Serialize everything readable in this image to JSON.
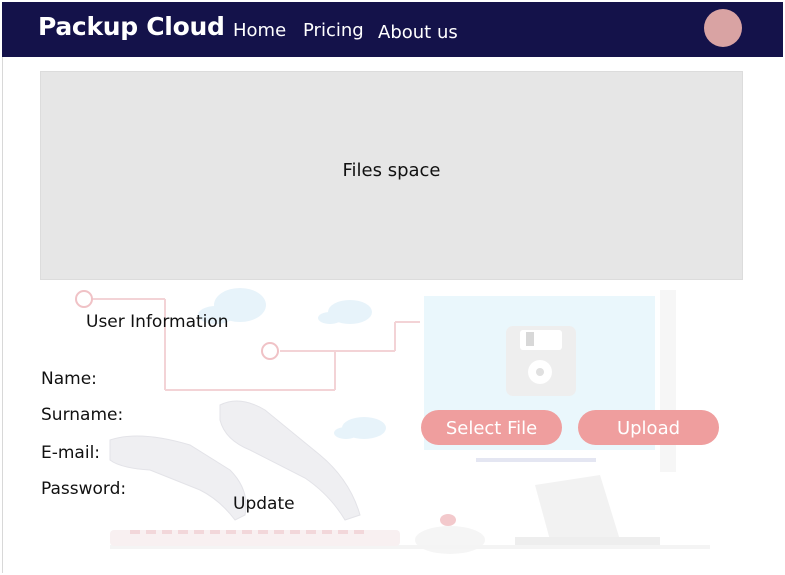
{
  "header": {
    "brand": "Packup Cloud",
    "nav": [
      {
        "label": "Home"
      },
      {
        "label": "Pricing"
      },
      {
        "label": "About us"
      }
    ]
  },
  "files": {
    "label": "Files space"
  },
  "user_info": {
    "title": "User Information",
    "fields": [
      {
        "label": "Name:"
      },
      {
        "label": "Surname:"
      },
      {
        "label": "E-mail:"
      },
      {
        "label": "Password:"
      }
    ],
    "update_label": "Update"
  },
  "upload": {
    "select_label": "Select File",
    "upload_label": "Upload"
  },
  "colors": {
    "navbar": "#14124a",
    "avatar": "#d9a3a3",
    "button": "#ef9e9e",
    "files_bg": "#e6e6e6"
  },
  "icons": [
    "avatar-icon",
    "floppy-disk-icon"
  ]
}
